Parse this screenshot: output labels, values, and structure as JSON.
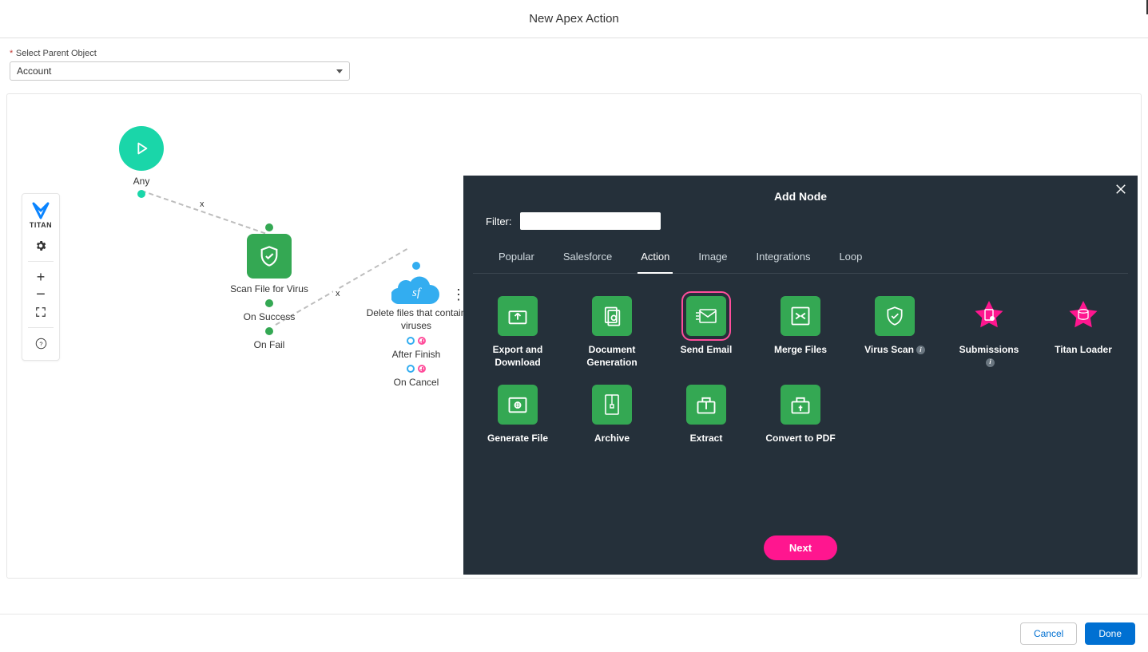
{
  "header": {
    "title": "New Apex Action"
  },
  "parentObject": {
    "label": "Select Parent Object",
    "required": "*",
    "value": "Account"
  },
  "toolbar": {
    "brand": "TITAN"
  },
  "flow": {
    "start": {
      "label": "Any"
    },
    "scan": {
      "label": "Scan File for Virus",
      "success": "On Success",
      "fail": "On Fail"
    },
    "sf": {
      "label": "Delete files that contain viruses",
      "after": "After Finish",
      "cancel": "On Cancel"
    }
  },
  "modal": {
    "title": "Add Node",
    "filterLabel": "Filter:",
    "filterValue": "",
    "tabs": [
      "Popular",
      "Salesforce",
      "Action",
      "Image",
      "Integrations",
      "Loop"
    ],
    "activeTab": "Action",
    "nodes": [
      {
        "name": "Export and Download",
        "kind": "green",
        "icon": "export"
      },
      {
        "name": "Document Generation",
        "kind": "green",
        "icon": "doc"
      },
      {
        "name": "Send Email",
        "kind": "green",
        "icon": "email",
        "selected": true
      },
      {
        "name": "Merge Files",
        "kind": "green",
        "icon": "merge"
      },
      {
        "name": "Virus Scan",
        "kind": "green",
        "icon": "shield",
        "info": true
      },
      {
        "name": "Submissions",
        "kind": "pink",
        "icon": "star-doc",
        "info": true
      },
      {
        "name": "Titan Loader",
        "kind": "pink",
        "icon": "star-db"
      },
      {
        "name": "Generate File",
        "kind": "green",
        "icon": "gen"
      },
      {
        "name": "Archive",
        "kind": "green",
        "icon": "zip"
      },
      {
        "name": "Extract",
        "kind": "green",
        "icon": "extract"
      },
      {
        "name": "Convert to PDF",
        "kind": "green",
        "icon": "pdf"
      }
    ],
    "next": "Next"
  },
  "footer": {
    "cancel": "Cancel",
    "done": "Done"
  }
}
